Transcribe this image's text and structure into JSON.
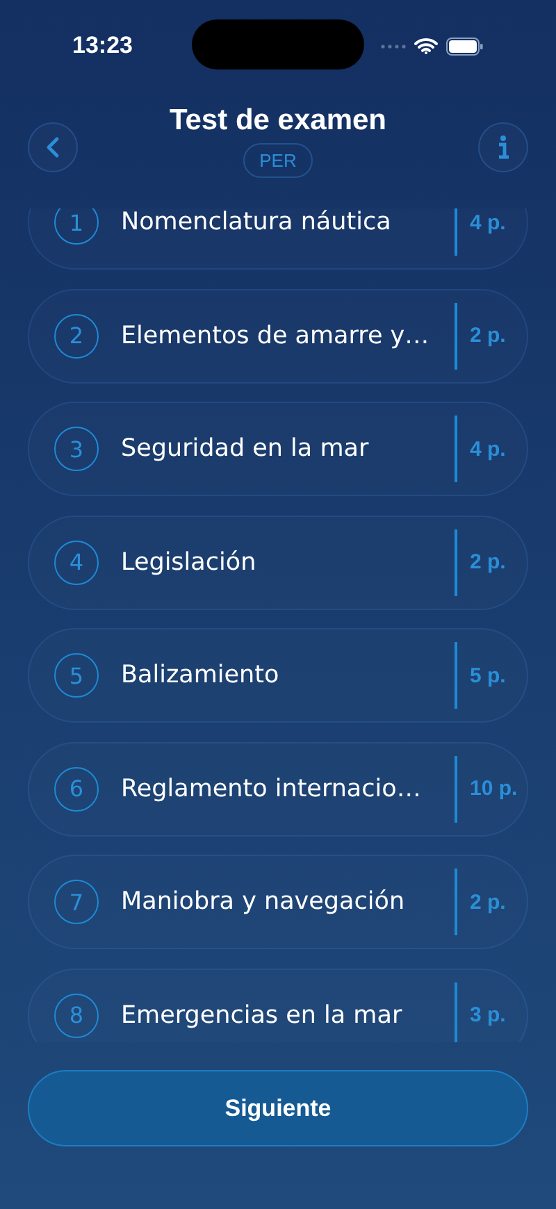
{
  "status_bar": {
    "time": "13:23"
  },
  "header": {
    "title": "Test de examen",
    "badge": "PER"
  },
  "topics": [
    {
      "number": "1",
      "label": "Nomenclatura náutica",
      "points": "4 p."
    },
    {
      "number": "2",
      "label": "Elementos de amarre y…",
      "points": "2 p."
    },
    {
      "number": "3",
      "label": "Seguridad en la mar",
      "points": "4 p."
    },
    {
      "number": "4",
      "label": "Legislación",
      "points": "2 p."
    },
    {
      "number": "5",
      "label": "Balizamiento",
      "points": "5 p."
    },
    {
      "number": "6",
      "label": "Reglamento internacio…",
      "points": "10 p."
    },
    {
      "number": "7",
      "label": "Maniobra y navegación",
      "points": "2 p."
    },
    {
      "number": "8",
      "label": "Emergencias en la mar",
      "points": "3 p."
    }
  ],
  "button": {
    "label": "Siguiente"
  }
}
